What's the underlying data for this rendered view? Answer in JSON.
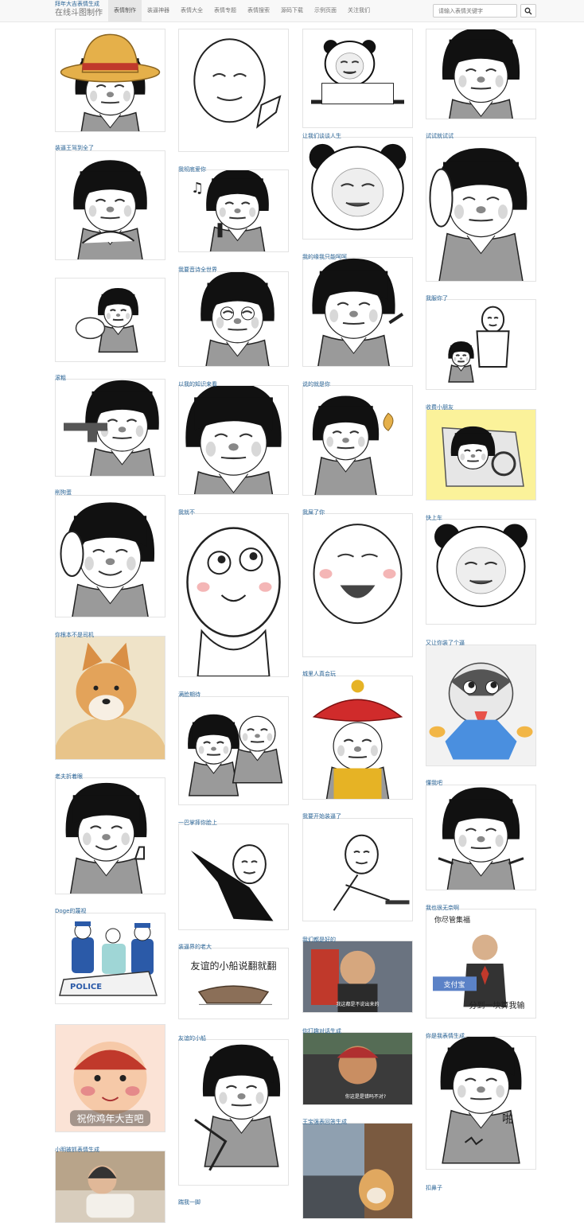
{
  "brand": "在线斗图制作",
  "nav": [
    "表情制作",
    "装逼神器",
    "表情大全",
    "表情专题",
    "表情搜索",
    "源码下载",
    "示例页面",
    "关注我们"
  ],
  "search": {
    "placeholder": "请输入表情关键字"
  },
  "columns": [
    {
      "captions": [
        "装逼王驾到全了",
        "",
        "滚粗",
        "削狗蛋",
        "你根本不是司机",
        "老夫折着眼",
        "Doge的蔑视",
        "",
        "小明被抓表情生成",
        "拜年大吉表情生成"
      ]
    },
    {
      "captions": [
        "我彻底爱你",
        "我要音诗全世界",
        "以我的知识来看",
        "我就不",
        "满脸期待",
        "一巴掌摔你脸上",
        "装逼界的老大",
        "友谊的小船",
        "踹我一脚"
      ]
    },
    {
      "captions": [
        "让我们谈谈人生",
        "我的缘我只能呵呵",
        "说的就是你",
        "我屎了你",
        "城里人真会玩",
        "我要开始装逼了",
        "我们都是好的",
        "你打趣对话生成",
        "王宝强表回答生成"
      ]
    },
    {
      "captions": [
        "试试就试试",
        "我服你了",
        "收费小朋友",
        "快上车",
        "又让你装了个逼",
        "懂我吧",
        "我也很无奈啊",
        "你是我表情生成",
        "扣鼻子"
      ]
    }
  ],
  "image_texts": {
    "boat": "友谊的小船说翻就翻",
    "alipay_title": "你尽管集福",
    "alipay_logo": "支付宝",
    "alipay_caption": "分到一块算我输",
    "baby": "祝你鸡年大吉吧",
    "police": "POLICE",
    "video1": "我这都是不说出来的",
    "video2": "你这是是错吗不对?",
    "ngh": "啪"
  },
  "colors": {
    "link": "#2a6496",
    "navbar_bg": "#f8f8f8",
    "active_bg": "#e7e7e7",
    "border": "#e3e3e3"
  }
}
